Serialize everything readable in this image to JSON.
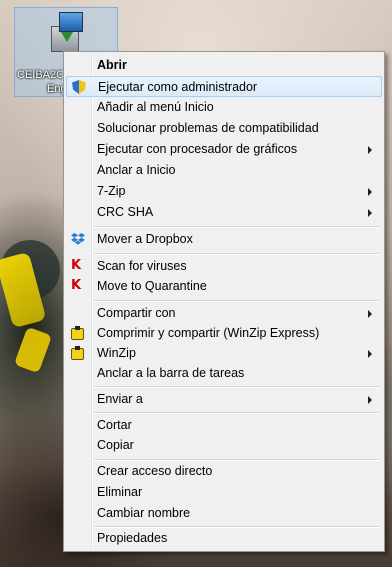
{
  "desktop": {
    "icon_label_line1": "CEIBA2C",
    "icon_label_line2": "Eng"
  },
  "menu": {
    "items": [
      {
        "label": "Abrir",
        "bold": true
      },
      {
        "label": "Ejecutar como administrador",
        "icon": "uac-shield-icon",
        "hover": true
      },
      {
        "label": "Añadir al menú Inicio"
      },
      {
        "label": "Solucionar problemas de compatibilidad"
      },
      {
        "label": "Ejecutar con procesador de gráficos",
        "submenu": true
      },
      {
        "label": "Anclar a Inicio"
      },
      {
        "label": "7-Zip",
        "submenu": true
      },
      {
        "label": "CRC SHA",
        "submenu": true
      },
      {
        "label": "Mover a Dropbox",
        "icon": "dropbox-icon"
      },
      {
        "label": "Scan for viruses",
        "icon": "kaspersky-icon"
      },
      {
        "label": "Move to Quarantine",
        "icon": "kaspersky-icon"
      },
      {
        "label": "Compartir con",
        "submenu": true
      },
      {
        "label": "Comprimir y compartir (WinZip Express)",
        "icon": "winzip-icon"
      },
      {
        "label": "WinZip",
        "icon": "winzip-icon",
        "submenu": true
      },
      {
        "label": "Anclar a la barra de tareas"
      },
      {
        "label": "Enviar a",
        "submenu": true
      },
      {
        "label": "Cortar"
      },
      {
        "label": "Copiar"
      },
      {
        "label": "Crear acceso directo"
      },
      {
        "label": "Eliminar"
      },
      {
        "label": "Cambiar nombre"
      },
      {
        "label": "Propiedades"
      }
    ]
  },
  "colors": {
    "menu_background": "#f0f0f0",
    "hover_border": "#a8cdf0",
    "kaspersky_red": "#d30000",
    "winzip_yellow": "#f3d21c"
  }
}
